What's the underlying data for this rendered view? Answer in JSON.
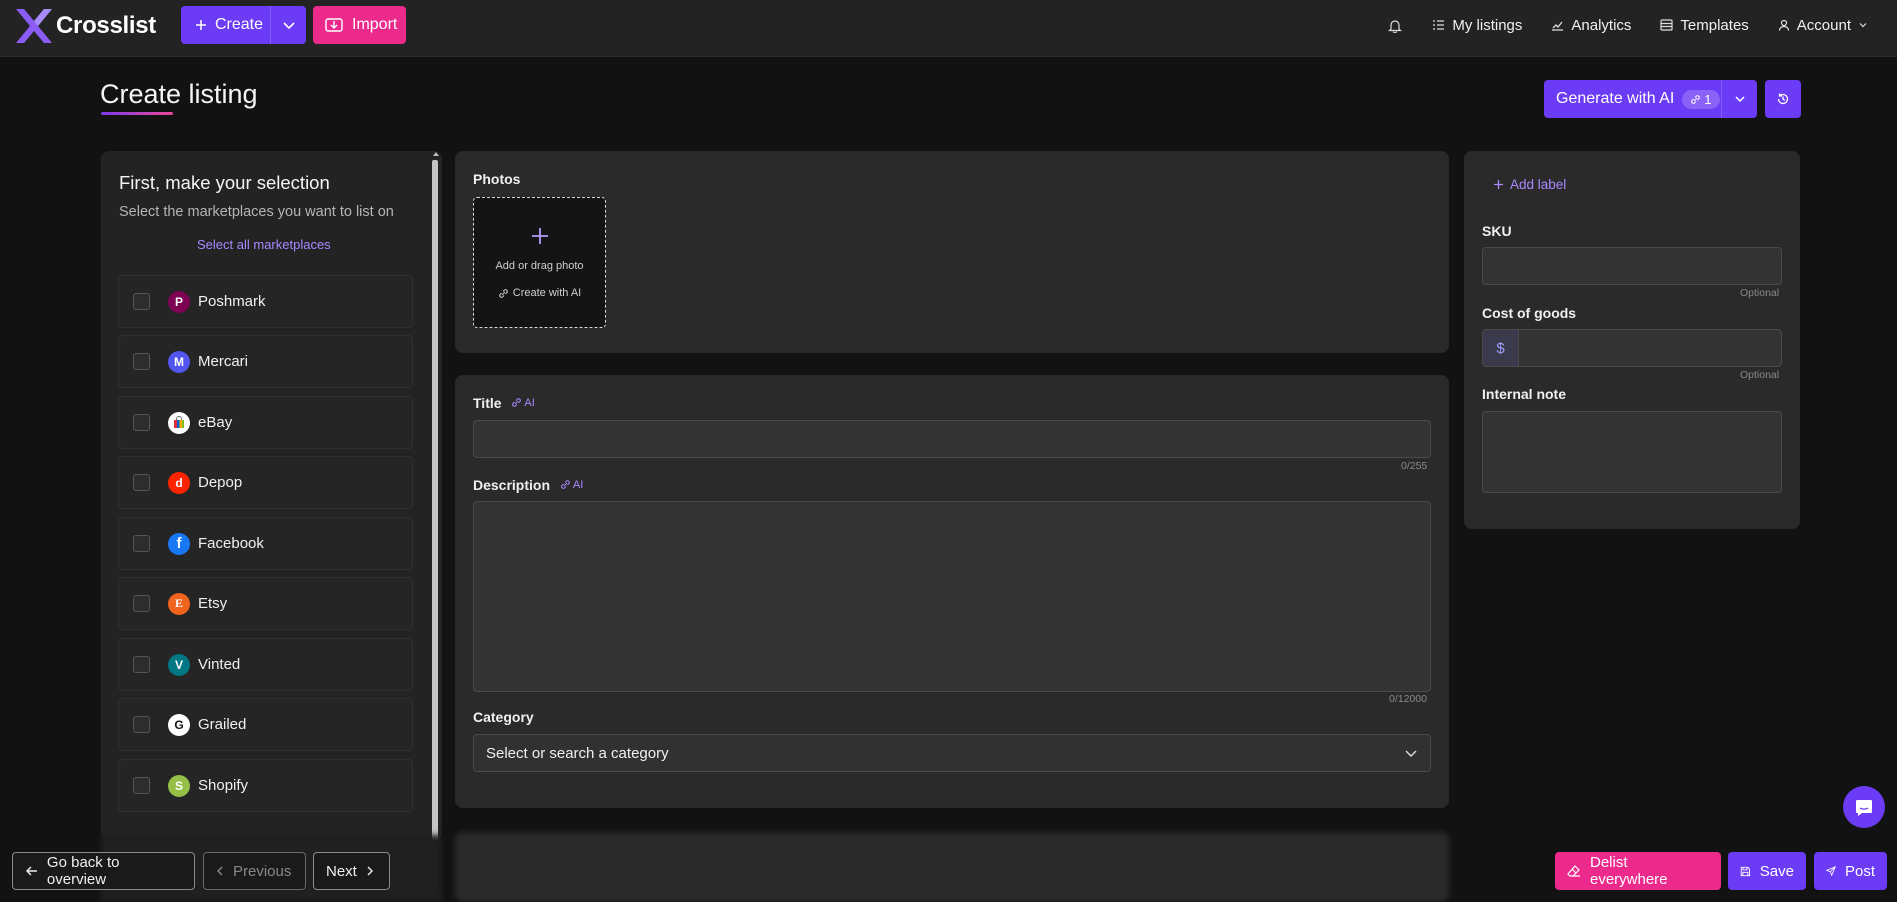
{
  "app": {
    "name": "Crosslist"
  },
  "topbar": {
    "create_label": "Create",
    "import_label": "Import",
    "nav": [
      {
        "label": "My listings",
        "icon": "list-icon"
      },
      {
        "label": "Analytics",
        "icon": "chart-icon"
      },
      {
        "label": "Templates",
        "icon": "template-icon"
      },
      {
        "label": "Account",
        "icon": "user-icon"
      }
    ]
  },
  "page": {
    "title": "Create listing",
    "generate_label": "Generate with AI",
    "generate_count": "1"
  },
  "marketplaces": {
    "heading": "First, make your selection",
    "subheading": "Select the marketplaces you want to list on",
    "select_all": "Select all marketplaces",
    "items": [
      {
        "label": "Poshmark",
        "color": "#7f0353",
        "glyph": "P"
      },
      {
        "label": "Mercari",
        "color": "#5356ee",
        "glyph": "M"
      },
      {
        "label": "eBay",
        "color": "#ffffff",
        "glyph": "e"
      },
      {
        "label": "Depop",
        "color": "#ff2300",
        "glyph": "d"
      },
      {
        "label": "Facebook",
        "color": "#1877f2",
        "glyph": "f"
      },
      {
        "label": "Etsy",
        "color": "#f1641e",
        "glyph": "E"
      },
      {
        "label": "Vinted",
        "color": "#007782",
        "glyph": "V"
      },
      {
        "label": "Grailed",
        "color": "#ffffff",
        "glyph": "G"
      },
      {
        "label": "Shopify",
        "color": "#95bf47",
        "glyph": "S"
      }
    ]
  },
  "form": {
    "photos_label": "Photos",
    "add_photo": "Add or drag photo",
    "create_with_ai": "Create with AI",
    "title_label": "Title",
    "ai_tag": "AI",
    "title_counter": "0/255",
    "description_label": "Description",
    "description_counter": "0/12000",
    "category_label": "Category",
    "category_placeholder": "Select or search a category"
  },
  "side": {
    "add_label": "Add label",
    "sku_label": "SKU",
    "optional": "Optional",
    "cost_label": "Cost of goods",
    "currency": "$",
    "note_label": "Internal note"
  },
  "footer": {
    "back": "Go back to overview",
    "previous": "Previous",
    "next": "Next",
    "delist": "Delist everywhere",
    "save": "Save",
    "post": "Post"
  },
  "colors": {
    "accent": "#6c3bf5",
    "pink": "#ec2a8c",
    "link": "#a889ff"
  }
}
